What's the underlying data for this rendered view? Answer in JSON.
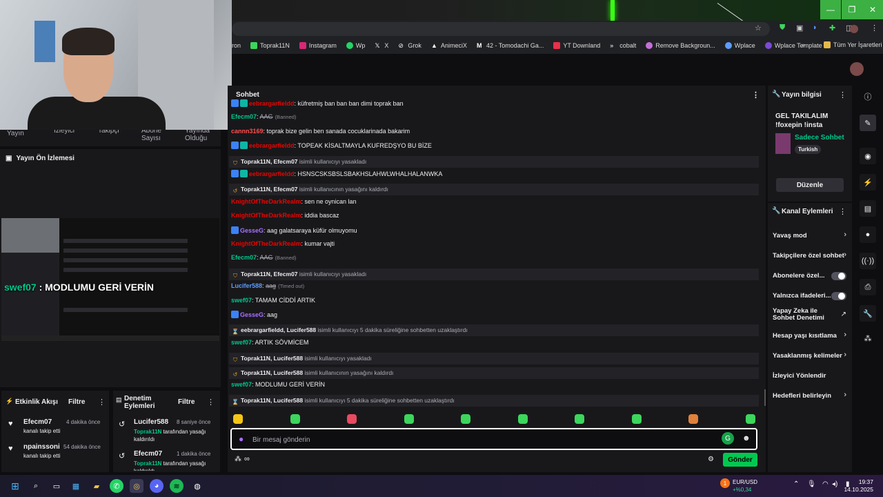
{
  "browser": {
    "bookmarks": [
      "ron",
      "Toprak11N",
      "Instagram",
      "Wp",
      "X",
      "Grok",
      "AnimeciX",
      "42 - Tomodachi Ga...",
      "YT Downland",
      "cobalt",
      "Remove Backgroun...",
      "Wplace",
      "Wplace Template"
    ],
    "all_bookmarks_label": "Tüm Yer İşaretleri",
    "chevron": "»"
  },
  "left": {
    "stats": [
      "Yayın",
      "İzleyici",
      "Takipçi",
      "Abone Sayısı",
      "Yayında Olduğu"
    ],
    "preview_title": "Yayın Ön İzlemesi",
    "preview_overlay_user": "swef07",
    "preview_overlay_text": " : MODLUMU GERİ VERİN",
    "activity": {
      "title": "Etkinlik Akışı",
      "filter": "Filtre",
      "events": [
        {
          "user": "Efecm07",
          "time": "4 dakika önce",
          "desc": "kanalı takip etti"
        },
        {
          "user": "npainssoni",
          "time": "54 dakika önce",
          "desc": "kanalı takip etti"
        }
      ]
    },
    "mod": {
      "title": "Denetim Eylemleri",
      "filter": "Filtre",
      "events": [
        {
          "user": "Lucifer588",
          "time": "8 saniye önce",
          "by": "Toprak11N",
          "desc": " tarafından yasağı kaldırıldı"
        },
        {
          "user": "Efecm07",
          "time": "1 dakika önce",
          "by": "Toprak11N",
          "desc": " tarafından yasağı kaldırıldı"
        }
      ]
    }
  },
  "chat": {
    "title": "Sohbet",
    "lines": [
      {
        "type": "msg",
        "badges": [
          "blue",
          "teal"
        ],
        "user": "eebrargarfieldd",
        "color": "#eb0400",
        "text": ": küfretmiş ban ban ban dimi toprak ban"
      },
      {
        "type": "msg",
        "badges": [],
        "user": "Efecm07",
        "color": "#00c98a",
        "strike": "AAG",
        "tag": "(Banned)"
      },
      {
        "type": "msg",
        "badges": [],
        "user": "cannn3169",
        "color": "#ff4f4f",
        "text": ": toprak bize gelin ben sanada cocuklarinada bakarim"
      },
      {
        "type": "msg",
        "badges": [
          "blue",
          "teal"
        ],
        "user": "eebrargarfieldd",
        "color": "#eb0400",
        "text": ": TOPEAK KİSALTMAYLA KUFREDŞYO BU BİZE"
      },
      {
        "type": "sys",
        "icon": "shield",
        "user": "Toprak11N, Efecm07",
        "text": " isimli kullanıcıyı yasakladı"
      },
      {
        "type": "msg",
        "badges": [
          "blue",
          "teal"
        ],
        "user": "eebrargarfieldd",
        "color": "#eb0400",
        "text": ": HSNSCSKSBSLSBAKHSLAHWLWHALHALANWKA"
      },
      {
        "type": "sys",
        "icon": "undo",
        "user": "Toprak11N, Efecm07",
        "text": " isimli kullanıcının yasağını kaldırdı"
      },
      {
        "type": "msg",
        "badges": [],
        "user": "KnightOfTheDarkRealm",
        "color": "#eb0400",
        "text": ": sen ne oynican lan"
      },
      {
        "type": "msg",
        "badges": [],
        "user": "KnightOfTheDarkRealm",
        "color": "#eb0400",
        "text": ": iddia bascaz"
      },
      {
        "type": "msg",
        "badges": [
          "blue"
        ],
        "user": "GesseG",
        "color": "#a970ff",
        "text": ": aag galatsaraya küfür olmuyomu"
      },
      {
        "type": "msg",
        "badges": [],
        "user": "KnightOfTheDarkRealm",
        "color": "#eb0400",
        "text": ": kumar vajti"
      },
      {
        "type": "msg",
        "badges": [],
        "user": "Efecm07",
        "color": "#00c98a",
        "strike": "AAG",
        "tag": "(Banned)"
      },
      {
        "type": "sys",
        "icon": "shield",
        "user": "Toprak11N, Efecm07",
        "text": " isimli kullanıcıyı yasakladı"
      },
      {
        "type": "msg",
        "badges": [],
        "user": "Lucifer588",
        "color": "#5c9cff",
        "strike": "aag",
        "tag": "(Timed out)"
      },
      {
        "type": "msg",
        "badges": [],
        "user": "swef07",
        "color": "#00c98a",
        "text": ": TAMAM CİDDİ ARTIK"
      },
      {
        "type": "msg",
        "badges": [
          "blue"
        ],
        "user": "GesseG",
        "color": "#a970ff",
        "text": ": aag"
      },
      {
        "type": "sys",
        "icon": "hourglass",
        "user": "eebrargarfieldd, Lucifer588",
        "text": " isimli kullanıcıyı 5 dakika süreliğine sohbetten uzaklaştırdı"
      },
      {
        "type": "msg",
        "badges": [],
        "user": "swef07",
        "color": "#00c98a",
        "text": ": ARTIK SÖVMİCEM"
      },
      {
        "type": "sys",
        "icon": "shield",
        "user": "Toprak11N, Lucifer588",
        "text": " isimli kullanıcıyı yasakladı"
      },
      {
        "type": "sys",
        "icon": "undo",
        "user": "Toprak11N, Lucifer588",
        "text": " isimli kullanıcının yasağını kaldırdı"
      },
      {
        "type": "msg",
        "badges": [],
        "user": "swef07",
        "color": "#00c98a",
        "text": ": MODLUMU GERİ VERİN"
      },
      {
        "type": "sys",
        "icon": "hourglass",
        "user": "Toprak11N, Lucifer588",
        "text": " isimli kullanıcıyı 5 dakika süreliğine sohbetten uzaklaştırdı"
      }
    ],
    "emote_colors": [
      "#f5c518",
      "#3cd65c",
      "#e84a5f",
      "#3cd65c",
      "#3cd65c",
      "#3cd65c",
      "#3cd65c",
      "#3cd65c",
      "#e0813c",
      "#3cd65c"
    ],
    "input_placeholder": "Bir mesaj gönderin",
    "send_label": "Gönder"
  },
  "right": {
    "info_title": "Yayın bilgisi",
    "stream_title": "GEL TAKILALIM !foxepin !insta",
    "category": "Sadece Sohbet",
    "tag": "Turkish",
    "edit_label": "Düzenle",
    "actions_title": "Kanal Eylemleri",
    "actions": [
      {
        "label": "Yavaş mod",
        "control": "chevron"
      },
      {
        "label": "Takipçilere özel sohbet",
        "control": "chevron"
      },
      {
        "label": "Abonelere özel...",
        "control": "toggle"
      },
      {
        "label": "Yalnızca ifadeleri...",
        "control": "toggle"
      },
      {
        "label": "Yapay Zeka ile Sohbet Denetimi",
        "control": "external"
      },
      {
        "label": "Hesap yaşı kısıtlama",
        "control": "chevron"
      },
      {
        "label": "Yasaklanmış kelimeler",
        "control": "chevron"
      },
      {
        "label": "İzleyici Yönlendir",
        "control": "none"
      },
      {
        "label": "Hedefleri belirleyin",
        "control": "chevron"
      }
    ]
  },
  "taskbar": {
    "ticker_name": "EUR/USD",
    "ticker_change": "+%0,34",
    "ticker_badge": "1",
    "time": "19:37",
    "date": "14.10.2025"
  }
}
